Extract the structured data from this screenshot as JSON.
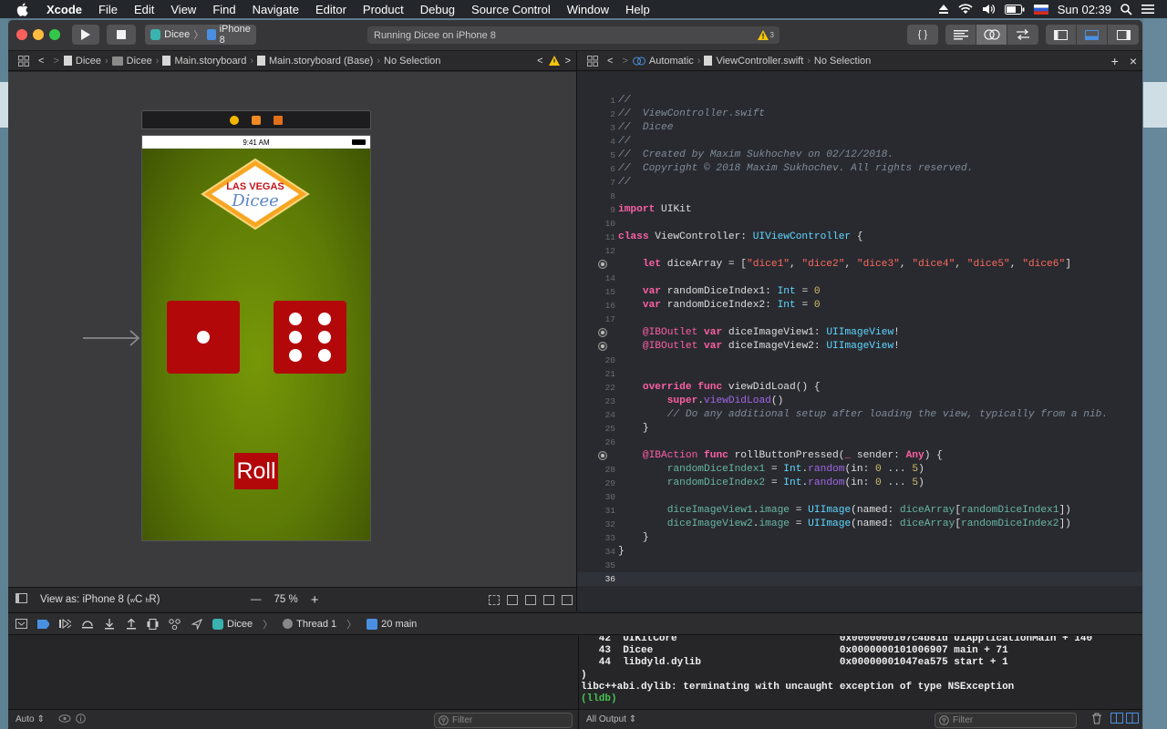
{
  "menubar": {
    "app_name": "Xcode",
    "items": [
      "File",
      "Edit",
      "View",
      "Find",
      "Navigate",
      "Editor",
      "Product",
      "Debug",
      "Source Control",
      "Window",
      "Help"
    ],
    "clock": "Sun 02:39"
  },
  "toolbar": {
    "scheme_app": "Dicee",
    "scheme_device": "iPhone 8",
    "activity_text": "Running Dicee on iPhone 8",
    "warning_count": "3"
  },
  "left_jumpbar": {
    "crumbs": [
      "Dicee",
      "Dicee",
      "Main.storyboard",
      "Main.storyboard (Base)",
      "No Selection"
    ]
  },
  "right_jumpbar": {
    "crumbs": [
      "Automatic",
      "ViewController.swift",
      "No Selection"
    ]
  },
  "storyboard": {
    "status_time": "9:41 AM",
    "logo_top": "LAS VEGAS",
    "logo_bottom": "Dicee",
    "roll_label": "Roll",
    "die1_face": 1,
    "die2_face": 6
  },
  "canvas_footer": {
    "view_as_prefix": "View as: iPhone 8 (",
    "view_as_w": "w",
    "view_as_c": "C",
    "view_as_h": "h",
    "view_as_r": "R",
    "view_as_suffix": ")",
    "zoom_minus": "—",
    "zoom": "75 %",
    "zoom_plus": "+"
  },
  "editor": {
    "current_line": 36,
    "breakpoint_lines": [
      13,
      18,
      19,
      27
    ],
    "lines": [
      [
        [
          "cm",
          "//"
        ]
      ],
      [
        [
          "cm",
          "//  ViewController.swift"
        ]
      ],
      [
        [
          "cm",
          "//  Dicee"
        ]
      ],
      [
        [
          "cm",
          "//"
        ]
      ],
      [
        [
          "cm",
          "//  Created by Maxim Sukhochev on 02/12/2018."
        ]
      ],
      [
        [
          "cm",
          "//  Copyright © 2018 Maxim Sukhochev. All rights reserved."
        ]
      ],
      [
        [
          "cm",
          "//"
        ]
      ],
      [],
      [
        [
          "kw",
          "import"
        ],
        [
          "tx",
          " UIKit"
        ]
      ],
      [],
      [
        [
          "kw",
          "class"
        ],
        [
          "tx",
          " ViewController: "
        ],
        [
          "ty",
          "UIViewController"
        ],
        [
          "tx",
          " {"
        ]
      ],
      [],
      [
        [
          "tx",
          "    "
        ],
        [
          "kw",
          "let"
        ],
        [
          "tx",
          " diceArray = ["
        ],
        [
          "st",
          "\"dice1\""
        ],
        [
          "tx",
          ", "
        ],
        [
          "st",
          "\"dice2\""
        ],
        [
          "tx",
          ", "
        ],
        [
          "st",
          "\"dice3\""
        ],
        [
          "tx",
          ", "
        ],
        [
          "st",
          "\"dice4\""
        ],
        [
          "tx",
          ", "
        ],
        [
          "st",
          "\"dice5\""
        ],
        [
          "tx",
          ", "
        ],
        [
          "st",
          "\"dice6\""
        ],
        [
          "tx",
          "]"
        ]
      ],
      [],
      [
        [
          "tx",
          "    "
        ],
        [
          "kw",
          "var"
        ],
        [
          "tx",
          " randomDiceIndex1: "
        ],
        [
          "ty",
          "Int"
        ],
        [
          "tx",
          " = "
        ],
        [
          "nm",
          "0"
        ]
      ],
      [
        [
          "tx",
          "    "
        ],
        [
          "kw",
          "var"
        ],
        [
          "tx",
          " randomDiceIndex2: "
        ],
        [
          "ty",
          "Int"
        ],
        [
          "tx",
          " = "
        ],
        [
          "nm",
          "0"
        ]
      ],
      [],
      [
        [
          "tx",
          "    "
        ],
        [
          "at",
          "@IBOutlet"
        ],
        [
          "tx",
          " "
        ],
        [
          "kw",
          "var"
        ],
        [
          "tx",
          " diceImageView1: "
        ],
        [
          "ty",
          "UIImageView"
        ],
        [
          "tx",
          "!"
        ]
      ],
      [
        [
          "tx",
          "    "
        ],
        [
          "at",
          "@IBOutlet"
        ],
        [
          "tx",
          " "
        ],
        [
          "kw",
          "var"
        ],
        [
          "tx",
          " diceImageView2: "
        ],
        [
          "ty",
          "UIImageView"
        ],
        [
          "tx",
          "!"
        ]
      ],
      [],
      [],
      [
        [
          "tx",
          "    "
        ],
        [
          "kw",
          "override"
        ],
        [
          "tx",
          " "
        ],
        [
          "kw",
          "func"
        ],
        [
          "tx",
          " viewDidLoad() {"
        ]
      ],
      [
        [
          "tx",
          "        "
        ],
        [
          "kw",
          "super"
        ],
        [
          "tx",
          "."
        ],
        [
          "fn",
          "viewDidLoad"
        ],
        [
          "tx",
          "()"
        ]
      ],
      [
        [
          "tx",
          "        "
        ],
        [
          "cm",
          "// Do any additional setup after loading the view, typically from a nib."
        ]
      ],
      [
        [
          "tx",
          "    }"
        ]
      ],
      [],
      [
        [
          "tx",
          "    "
        ],
        [
          "at",
          "@IBAction"
        ],
        [
          "tx",
          " "
        ],
        [
          "kw",
          "func"
        ],
        [
          "tx",
          " rollButtonPressed("
        ],
        [
          "kw",
          "_"
        ],
        [
          "tx",
          " sender: "
        ],
        [
          "kw",
          "Any"
        ],
        [
          "tx",
          ") {"
        ]
      ],
      [
        [
          "tx",
          "        "
        ],
        [
          "id",
          "randomDiceIndex1"
        ],
        [
          "tx",
          " = "
        ],
        [
          "ty",
          "Int"
        ],
        [
          "tx",
          "."
        ],
        [
          "fn",
          "random"
        ],
        [
          "tx",
          "(in: "
        ],
        [
          "nm",
          "0"
        ],
        [
          "tx",
          " ... "
        ],
        [
          "nm",
          "5"
        ],
        [
          "tx",
          ")"
        ]
      ],
      [
        [
          "tx",
          "        "
        ],
        [
          "id",
          "randomDiceIndex2"
        ],
        [
          "tx",
          " = "
        ],
        [
          "ty",
          "Int"
        ],
        [
          "tx",
          "."
        ],
        [
          "fn",
          "random"
        ],
        [
          "tx",
          "(in: "
        ],
        [
          "nm",
          "0"
        ],
        [
          "tx",
          " ... "
        ],
        [
          "nm",
          "5"
        ],
        [
          "tx",
          ")"
        ]
      ],
      [],
      [
        [
          "tx",
          "        "
        ],
        [
          "id",
          "diceImageView1"
        ],
        [
          "tx",
          "."
        ],
        [
          "id",
          "image"
        ],
        [
          "tx",
          " = "
        ],
        [
          "ty",
          "UIImage"
        ],
        [
          "tx",
          "(named: "
        ],
        [
          "id",
          "diceArray"
        ],
        [
          "tx",
          "["
        ],
        [
          "id",
          "randomDiceIndex1"
        ],
        [
          "tx",
          "])"
        ]
      ],
      [
        [
          "tx",
          "        "
        ],
        [
          "id",
          "diceImageView2"
        ],
        [
          "tx",
          "."
        ],
        [
          "id",
          "image"
        ],
        [
          "tx",
          " = "
        ],
        [
          "ty",
          "UIImage"
        ],
        [
          "tx",
          "(named: "
        ],
        [
          "id",
          "diceArray"
        ],
        [
          "tx",
          "["
        ],
        [
          "id",
          "randomDiceIndex2"
        ],
        [
          "tx",
          "])"
        ]
      ],
      [
        [
          "tx",
          "    }"
        ]
      ],
      [
        [
          "tx",
          "}"
        ]
      ],
      [],
      []
    ]
  },
  "debugbar": {
    "crumbs": [
      "Dicee",
      "Thread 1",
      "20 main"
    ]
  },
  "console": {
    "lines": [
      "   42  UIKitCore                           0x0000000107c4b81d UIApplicationMain + 140",
      "   43  Dicee                               0x0000000101006907 main + 71",
      "   44  libdyld.dylib                       0x00000001047ea575 start + 1",
      ")",
      "libc++abi.dylib: terminating with uncaught exception of type NSException",
      "(lldb)"
    ]
  },
  "bottom": {
    "auto_label": "Auto",
    "filter_placeholder": "Filter",
    "output_label": "All Output"
  },
  "colors": {
    "accent": "#4a90e2",
    "die_red": "#b3080a",
    "felt_green": "#6f8c06"
  }
}
